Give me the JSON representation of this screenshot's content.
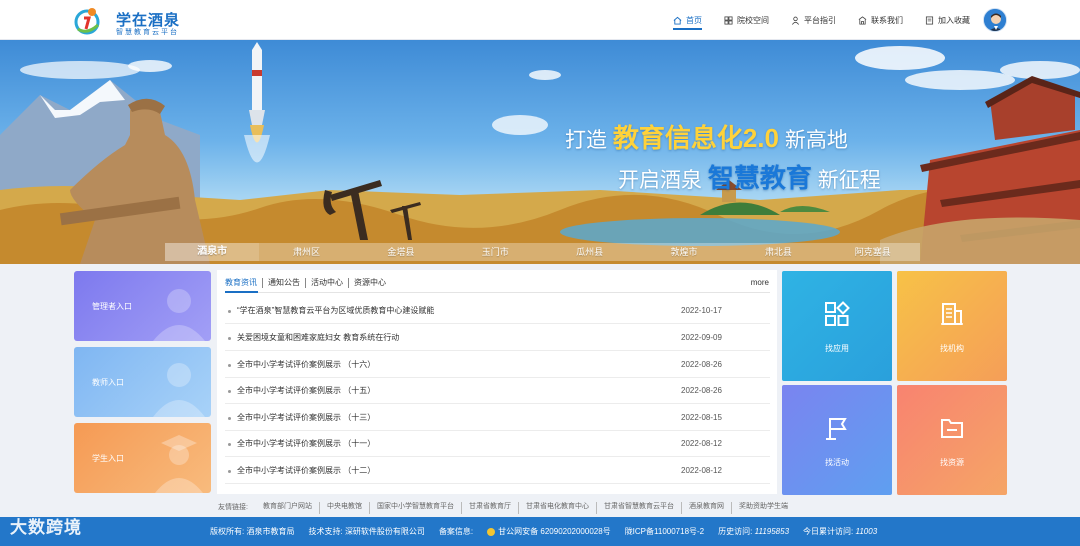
{
  "header": {
    "logo_title": "学在酒泉",
    "logo_subtitle": "智慧教育云平台",
    "nav": [
      {
        "label": "首页",
        "icon": "home-icon",
        "active": true
      },
      {
        "label": "院校空间",
        "icon": "grid-icon",
        "active": false
      },
      {
        "label": "平台指引",
        "icon": "user-guide-icon",
        "active": false
      },
      {
        "label": "联系我们",
        "icon": "building-icon",
        "active": false
      },
      {
        "label": "加入收藏",
        "icon": "bookmark-icon",
        "active": false
      }
    ]
  },
  "banner": {
    "slogan1_pre": "打造",
    "slogan1_hl": "教育信息化2.0",
    "slogan1_post": "新高地",
    "slogan2_pre": "开启酒泉",
    "slogan2_hl": "智慧教育",
    "slogan2_post": "新征程",
    "cities": [
      "酒泉市",
      "肃州区",
      "金塔县",
      "玉门市",
      "瓜州县",
      "敦煌市",
      "肃北县",
      "阿克塞县"
    ]
  },
  "entries": [
    {
      "label": "管理者入口",
      "color": "#8c86f0"
    },
    {
      "label": "教师入口",
      "color": "#8ec3f4"
    },
    {
      "label": "学生入口",
      "color": "#f6a865"
    }
  ],
  "news": {
    "tabs": [
      "教育资讯",
      "通知公告",
      "活动中心",
      "资源中心"
    ],
    "more": "more",
    "items": [
      {
        "title": "“学在酒泉”智慧教育云平台为区域优质教育中心建设赋能",
        "date": "2022-10-17"
      },
      {
        "title": "关爱困境女童和困难家庭妇女 教育系统在行动",
        "date": "2022-09-09"
      },
      {
        "title": "全市中小学考试评价案例展示 （十六）",
        "date": "2022-08-26"
      },
      {
        "title": "全市中小学考试评价案例展示 （十五）",
        "date": "2022-08-26"
      },
      {
        "title": "全市中小学考试评价案例展示 （十三）",
        "date": "2022-08-15"
      },
      {
        "title": "全市中小学考试评价案例展示 （十一）",
        "date": "2022-08-12"
      },
      {
        "title": "全市中小学考试评价案例展示 （十二）",
        "date": "2022-08-12"
      }
    ]
  },
  "tiles": [
    {
      "label": "找应用",
      "icon": "apps-icon"
    },
    {
      "label": "找机构",
      "icon": "institution-icon"
    },
    {
      "label": "找活动",
      "icon": "flag-icon"
    },
    {
      "label": "找资源",
      "icon": "folder-icon"
    }
  ],
  "links": {
    "label": "友情链接:",
    "items": [
      "教育部门户网站",
      "中央电教馆",
      "国家中小学智慧教育平台",
      "甘肃省教育厅",
      "甘肃省电化教育中心",
      "甘肃省智慧教育云平台",
      "酒泉教育网",
      "奖助资助学生端"
    ]
  },
  "footer": {
    "copyright_label": "版权所有:",
    "copyright": "酒泉市教育局",
    "support_label": "技术支持:",
    "support": "深研软件股份有限公司",
    "record_label": "备案信息:",
    "gongan": "甘公网安备 62090202000028号",
    "icp": "陇ICP备11000718号-2",
    "history_label": "历史访问:",
    "history": "11195853",
    "today_label": "今日累计访问:",
    "today": "11003"
  },
  "watermark": "大数跨境"
}
